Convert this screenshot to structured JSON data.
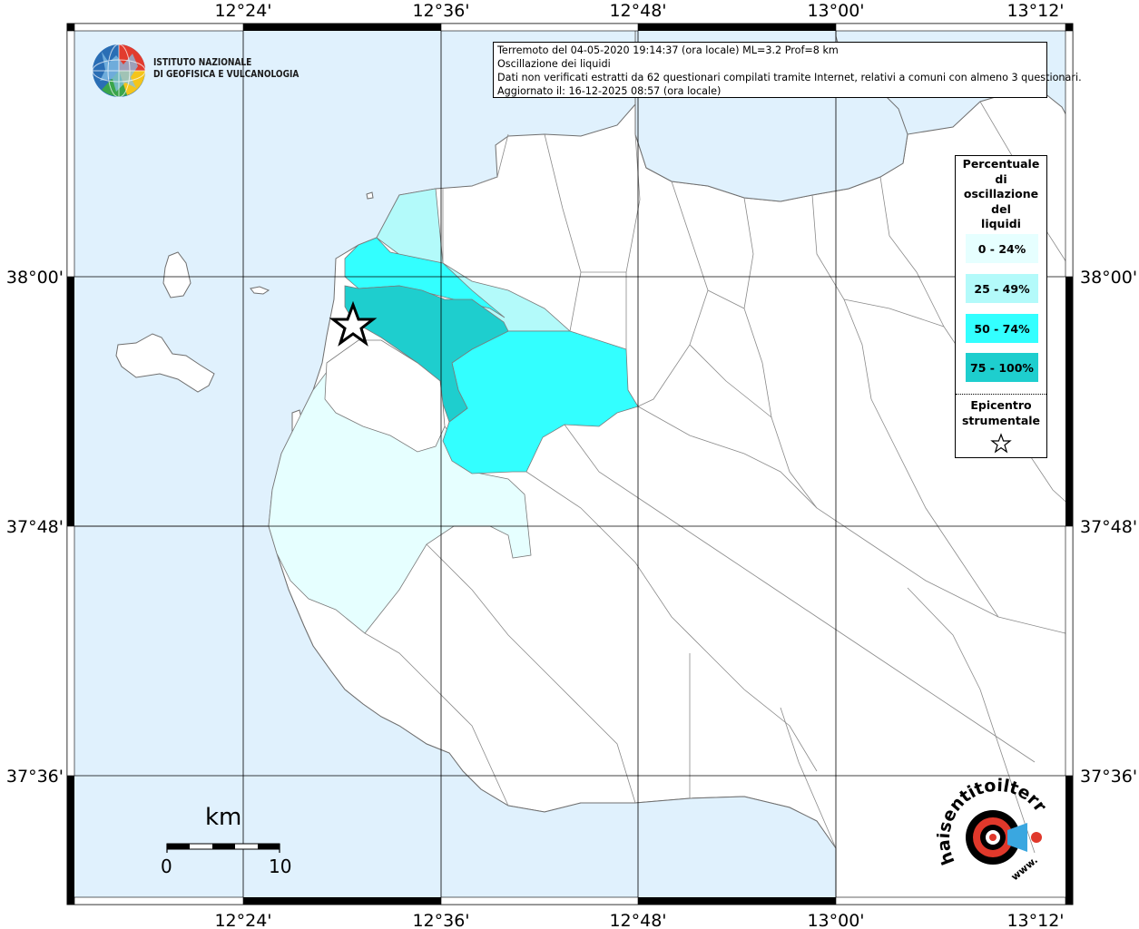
{
  "info": {
    "line1": "Terremoto del 04-05-2020 19:14:37 (ora locale) ML=3.2 Prof=8 km",
    "line2": "Oscillazione dei liquidi",
    "line3": "Dati non verificati estratti da 62 questionari compilati tramite Internet, relativi a comuni con almeno 3 questionari.",
    "line4": "Aggiornato il: 16-12-2025 08:57 (ora locale)"
  },
  "institute": {
    "line1": "ISTITUTO NAZIONALE",
    "line2": "DI GEOFISICA E VULCANOLOGIA"
  },
  "axes": {
    "lon_labels": [
      "12°24'",
      "12°36'",
      "12°48'",
      "13°00'",
      "13°12'"
    ],
    "lat_labels": [
      "38°00'",
      "37°48'",
      "37°36'"
    ]
  },
  "legend": {
    "title": [
      "Percentuale",
      "di",
      "oscillazione",
      "del",
      "liquidi"
    ],
    "classes": [
      {
        "label": "0 - 24%",
        "color": "#e6ffff"
      },
      {
        "label": "25 - 49%",
        "color": "#b3fafa"
      },
      {
        "label": "50 - 74%",
        "color": "#33ffff"
      },
      {
        "label": "75 - 100%",
        "color": "#1ecece"
      }
    ],
    "epicenter": [
      "Epicentro",
      "strumentale"
    ]
  },
  "scale": {
    "unit": "km",
    "min": "0",
    "max": "10"
  },
  "brand": {
    "text_arc": "haisentitoilterremoto.it",
    "text_www": "www."
  },
  "colors": {
    "sea": "#e0f1fd",
    "land": "#ffffff",
    "border": "#888888"
  }
}
